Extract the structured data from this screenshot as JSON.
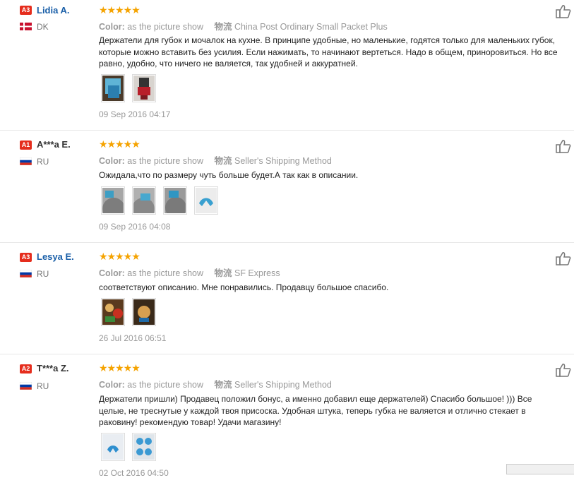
{
  "colors": {
    "star": "#f5a300",
    "name_link": "#1a5fa8",
    "badge_a3": "#e52d1d",
    "badge_a1": "#e52d1d",
    "badge_a2": "#e52d1d"
  },
  "labels": {
    "color_label": "Color:",
    "shipping_label": "物流"
  },
  "reviews": [
    {
      "badge": "A3",
      "name": "Lidia A.",
      "country": "DK",
      "flag": "flag-denmark-icon",
      "rating": 5,
      "stars": "★★★★★",
      "color_value": "as the picture show",
      "shipping": "China Post Ordinary Small Packet Plus",
      "text": "Держатели для губок и мочалок на кухне. В принципе удобные, но маленькие, годятся только для маленьких губок, которые можно вставить без усилия. Если нажимать, то начинают вертеться. Надо в общем, приноровиться. Но все равно, удобно, что ничего не валяется, так удобней и аккуратней.",
      "photos": [
        "photo-1",
        "photo-2"
      ],
      "date": "09 Sep 2016 04:17"
    },
    {
      "badge": "A1",
      "name": "A***a E.",
      "country": "RU",
      "flag": "flag-russia-icon",
      "rating": 5,
      "stars": "★★★★★",
      "color_value": "as the picture show",
      "shipping": "Seller's Shipping Method",
      "text": "Ожидала,что по размеру чуть больше будет.А так как в описании.",
      "photos": [
        "photo-1",
        "photo-2",
        "photo-3",
        "photo-4"
      ],
      "date": "09 Sep 2016 04:08"
    },
    {
      "badge": "A3",
      "name": "Lesya E.",
      "country": "RU",
      "flag": "flag-russia-icon",
      "rating": 5,
      "stars": "★★★★★",
      "color_value": "as the picture show",
      "shipping": "SF Express",
      "text": "соответствуют описанию. Мне понравились. Продавцу большое спасибо.",
      "photos": [
        "photo-1",
        "photo-2"
      ],
      "date": "26 Jul 2016 06:51"
    },
    {
      "badge": "A2",
      "name": "T***a Z.",
      "country": "RU",
      "flag": "flag-russia-icon",
      "rating": 5,
      "stars": "★★★★★",
      "color_value": "as the picture show",
      "shipping": "Seller's Shipping Method",
      "text": "Держатели пришли) Продавец положил бонус, а именно добавил еще держателей) Спасибо большое! ))) Все целые, не треснутые у каждой твоя присоска. Удобная штука, теперь губка не валяется и отлично стекает в раковину! рекомендую товар! Удачи магазину!",
      "photos": [
        "photo-1",
        "photo-2"
      ],
      "date": "02 Oct 2016 04:50"
    }
  ]
}
